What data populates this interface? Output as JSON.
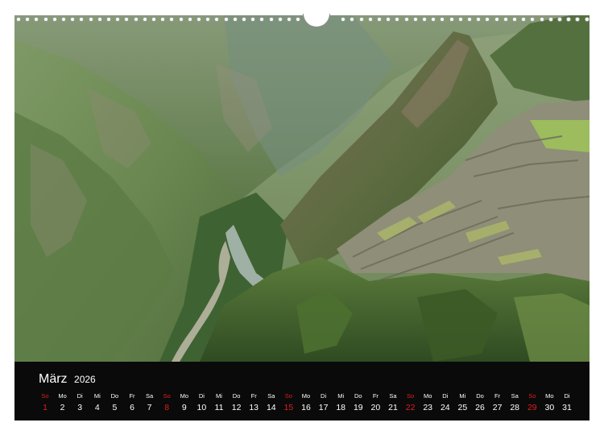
{
  "calendar": {
    "month": "März",
    "year": "2026",
    "accent_sunday_color": "#e01f1f",
    "days": [
      {
        "wd": "So",
        "d": "1",
        "sun": true
      },
      {
        "wd": "Mo",
        "d": "2"
      },
      {
        "wd": "Di",
        "d": "3"
      },
      {
        "wd": "Mi",
        "d": "4"
      },
      {
        "wd": "Do",
        "d": "5"
      },
      {
        "wd": "Fr",
        "d": "6"
      },
      {
        "wd": "Sa",
        "d": "7"
      },
      {
        "wd": "So",
        "d": "8",
        "sun": true
      },
      {
        "wd": "Mo",
        "d": "9"
      },
      {
        "wd": "Di",
        "d": "10"
      },
      {
        "wd": "Mi",
        "d": "11"
      },
      {
        "wd": "Do",
        "d": "12"
      },
      {
        "wd": "Fr",
        "d": "13"
      },
      {
        "wd": "Sa",
        "d": "14"
      },
      {
        "wd": "So",
        "d": "15",
        "sun": true
      },
      {
        "wd": "Mo",
        "d": "16"
      },
      {
        "wd": "Di",
        "d": "17"
      },
      {
        "wd": "Mi",
        "d": "18"
      },
      {
        "wd": "Do",
        "d": "19"
      },
      {
        "wd": "Fr",
        "d": "20"
      },
      {
        "wd": "Sa",
        "d": "21"
      },
      {
        "wd": "So",
        "d": "22",
        "sun": true
      },
      {
        "wd": "Mo",
        "d": "23"
      },
      {
        "wd": "Di",
        "d": "24"
      },
      {
        "wd": "Mi",
        "d": "25"
      },
      {
        "wd": "Do",
        "d": "26"
      },
      {
        "wd": "Fr",
        "d": "27"
      },
      {
        "wd": "Sa",
        "d": "28"
      },
      {
        "wd": "So",
        "d": "29",
        "sun": true
      },
      {
        "wd": "Mo",
        "d": "30"
      },
      {
        "wd": "Di",
        "d": "31"
      }
    ]
  }
}
